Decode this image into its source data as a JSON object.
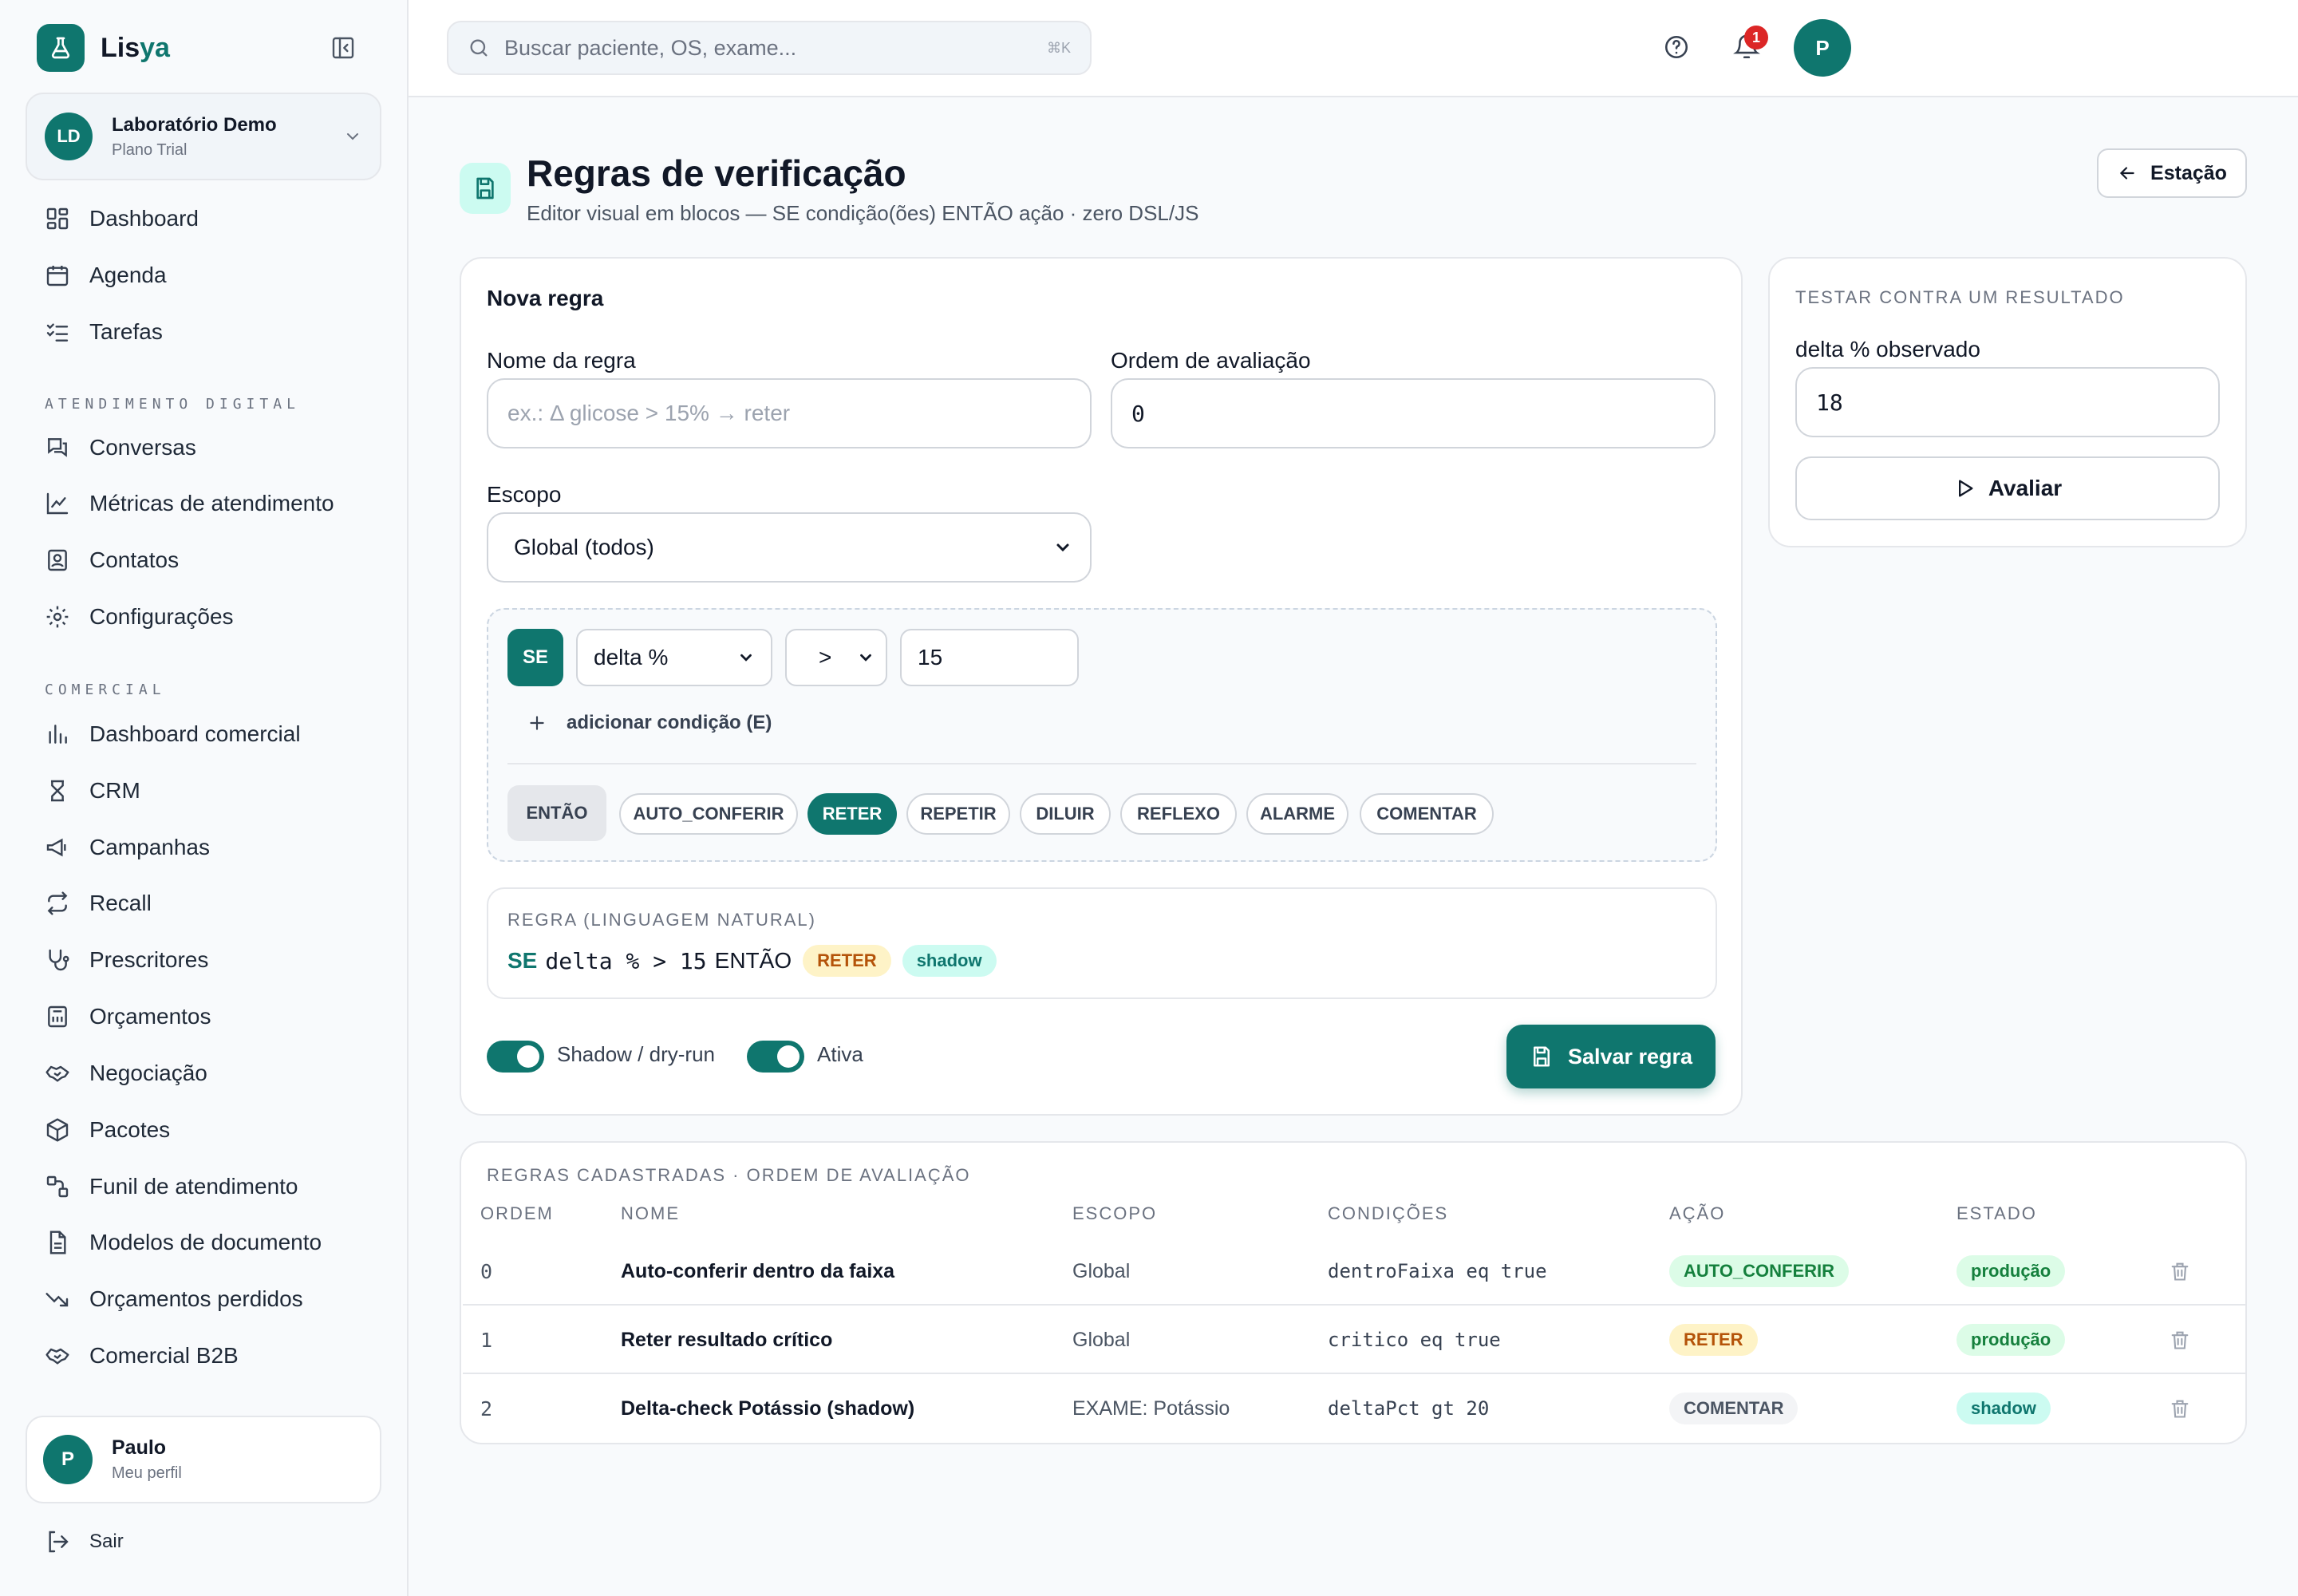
{
  "app": {
    "name_a": "Lis",
    "name_b": "ya"
  },
  "org": {
    "initials": "LD",
    "name": "Laboratório Demo",
    "plan": "Plano Trial"
  },
  "nav": {
    "main": [
      "Dashboard",
      "Agenda",
      "Tarefas"
    ],
    "sec1": "ATENDIMENTO DIGITAL",
    "atendimento": [
      "Conversas",
      "Métricas de atendimento",
      "Contatos",
      "Configurações"
    ],
    "sec2": "COMERCIAL",
    "comercial": [
      "Dashboard comercial",
      "CRM",
      "Campanhas",
      "Recall",
      "Prescritores",
      "Orçamentos",
      "Negociação",
      "Pacotes",
      "Funil de atendimento",
      "Modelos de documento",
      "Orçamentos perdidos",
      "Comercial B2B"
    ]
  },
  "user": {
    "initial": "P",
    "name": "Paulo",
    "sub": "Meu perfil"
  },
  "logout": "Sair",
  "search": {
    "placeholder": "Buscar paciente, OS, exame...",
    "shortcut": "⌘K"
  },
  "notifications": {
    "count": "1"
  },
  "top_avatar": "P",
  "page": {
    "title": "Regras de verificação",
    "subtitle": "Editor visual em blocos — SE condição(ões) ENTÃO ação · zero DSL/JS",
    "back": "Estação"
  },
  "form": {
    "title": "Nova regra",
    "name_label": "Nome da regra",
    "name_placeholder": "ex.: Δ glicose > 15% → reter",
    "order_label": "Ordem de avaliação",
    "order_value": "0",
    "scope_label": "Escopo",
    "scope_value": "Global (todos)",
    "se": "SE",
    "field": "delta %",
    "op": ">",
    "value": "15",
    "add_cond": "adicionar condição (E)",
    "entao": "ENTÃO",
    "actions": [
      "AUTO_CONFERIR",
      "RETER",
      "REPETIR",
      "DILUIR",
      "REFLEXO",
      "ALARME",
      "COMENTAR"
    ],
    "selected_action": "RETER",
    "nl_label": "REGRA (LINGUAGEM NATURAL)",
    "nl": {
      "se": "SE",
      "expr": "delta % > 15",
      "entao": "ENTÃO",
      "action": "RETER",
      "mode": "shadow"
    },
    "shadow_label": "Shadow / dry-run",
    "shadow_on": true,
    "active_label": "Ativa",
    "active_on": true,
    "save": "Salvar regra"
  },
  "test": {
    "title": "TESTAR CONTRA UM RESULTADO",
    "label": "delta % observado",
    "value": "18",
    "button": "Avaliar"
  },
  "table": {
    "title": "REGRAS CADASTRADAS · ORDEM DE AVALIAÇÃO",
    "headers": [
      "ORDEM",
      "NOME",
      "ESCOPO",
      "CONDIÇÕES",
      "AÇÃO",
      "ESTADO"
    ],
    "rows": [
      {
        "order": "0",
        "name": "Auto-conferir dentro da faixa",
        "scope": "Global",
        "cond": "dentroFaixa eq true",
        "action": "AUTO_CONFERIR",
        "state": "produção"
      },
      {
        "order": "1",
        "name": "Reter resultado crítico",
        "scope": "Global",
        "cond": "critico eq true",
        "action": "RETER",
        "state": "produção"
      },
      {
        "order": "2",
        "name": "Delta-check Potássio (shadow)",
        "scope": "EXAME: Potássio",
        "cond": "deltaPct gt 20",
        "action": "COMENTAR",
        "state": "shadow"
      }
    ]
  },
  "colors": {
    "accent": "#0f766e",
    "danger": "#dc2626",
    "amber": "#b45309"
  }
}
